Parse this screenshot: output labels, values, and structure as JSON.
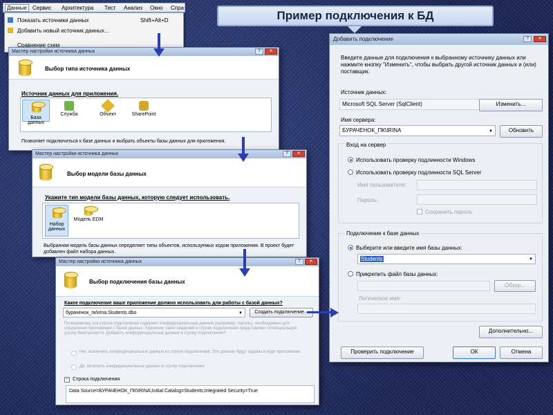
{
  "slide_title": "Пример подключения к БД",
  "menubar": [
    "Данные",
    "Сервис",
    "Архитектура",
    "Тест",
    "Анализ",
    "Окно",
    "Спра"
  ],
  "menu": {
    "items": [
      {
        "label": "Показать источники данных",
        "shortcut": "Shift+Alt+D"
      },
      {
        "label": "Добавить новый источник данных..."
      },
      {
        "label": "Сравнение схем"
      }
    ]
  },
  "wiz1": {
    "title": "Мастер настройки источника данных",
    "heading": "Выбор типа источника данных",
    "prompt": "Источник данных для приложения.",
    "items": [
      "База данных",
      "Служба",
      "Объект",
      "SharePoint"
    ],
    "desc": "Позволяет подключиться к базе данных и выбрать объекты базы данных для приложения."
  },
  "wiz2": {
    "title": "Мастер настройки источника данных",
    "heading": "Выбор модели базы данных",
    "prompt": "Укажите тип модели базы данных, которую следует использовать.",
    "items": [
      "Набор данных",
      "Модель EDM"
    ],
    "desc": "Выбранная модель базы данных определяет типы объектов, используемых кодом приложения. В проект будет добавлен файл набора данных."
  },
  "wiz3": {
    "title": "Мастер настройки источника данных",
    "heading": "Выбор подключения базы данных",
    "question": "Какое подключение ваше приложение должно использовать для работы с базой данных?",
    "connection": "бураченок_пк\\irina.Students.dbo",
    "create_btn": "Создать подключение...",
    "warn": "По-видимому, эта строка подключения содержит конфиденциальные данные (например, пароль), необходимые для соединения приложения с базой данных. Хранение таких сведений в строке подключения представляет потенциальную угрозу безопасности. Добавить конфиденциальные данные в строку подключения?",
    "opt_no": "Нет, исключить конфиденциальные данные из строки подключения. Эти данные будут заданы в коде приложения.",
    "opt_yes": "Да, включить конфиденциальные данные в строку подключения.",
    "conn_label": "Строка подключения",
    "conn_string": "Data Source=БУРАЧЕНОК_ПК\\IRINA;Initial Catalog=Students;Integrated Security=True"
  },
  "dlg": {
    "title": "Добавить подключение",
    "intro": "Введите данные для подключения к выбранному источнику данных или нажмите кнопку \"Изменить\", чтобы выбрать другой источник данных и (или) поставщик.",
    "source_label": "Источник данных:",
    "source_value": "Microsoft SQL Server (SqlClient)",
    "change_btn": "Изменить...",
    "server_label": "Имя сервера:",
    "server_value": "БУРАЧЕНОК_ПК\\IRINA",
    "refresh_btn": "Обновить",
    "login_group": "Вход на сервер",
    "auth_windows": "Использовать проверку подлинности Windows",
    "auth_sql": "Использовать проверку подлинности SQL Server",
    "user_label": "Имя пользователя:",
    "pass_label": "Пароль:",
    "save_pass": "Сохранить пароль",
    "db_group": "Подключение к базе данных",
    "db_select": "Выберите или введите имя базы данных:",
    "db_value": "Students",
    "attach": "Прикрепить файл базы данных:",
    "browse_btn": "Обзор...",
    "logical": "Логическое имя:",
    "advanced_btn": "Дополнительно...",
    "test_btn": "Проверить подключение",
    "ok_btn": "ОК",
    "cancel_btn": "Отмена"
  }
}
